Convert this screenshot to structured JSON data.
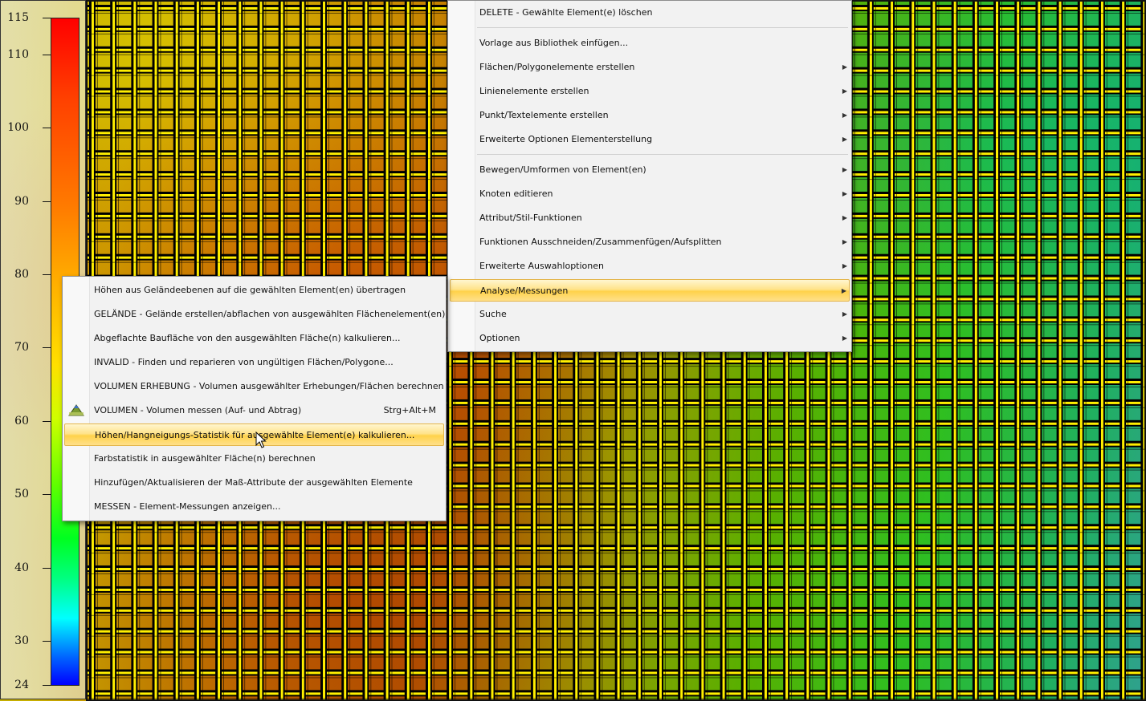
{
  "legend": {
    "ticks": [
      {
        "label": "115",
        "value": 115
      },
      {
        "label": "110",
        "value": 110
      },
      {
        "label": "100",
        "value": 100
      },
      {
        "label": "90",
        "value": 90
      },
      {
        "label": "80",
        "value": 80
      },
      {
        "label": "70",
        "value": 70
      },
      {
        "label": "60",
        "value": 60
      },
      {
        "label": "50",
        "value": 50
      },
      {
        "label": "40",
        "value": 40
      },
      {
        "label": "30",
        "value": 30
      },
      {
        "label": "24",
        "value": 24
      }
    ],
    "colors": {
      "top": "#ff0000",
      "bottom": "#0000ff"
    }
  },
  "context_menu": {
    "items": [
      {
        "label": "DELETE - Gewählte Element(e) löschen",
        "submenu": false
      },
      {
        "separator": true
      },
      {
        "label": "Vorlage aus Bibliothek einfügen...",
        "submenu": false
      },
      {
        "label": "Flächen/Polygonelemente erstellen",
        "submenu": true
      },
      {
        "label": "Linienelemente erstellen",
        "submenu": true
      },
      {
        "label": "Punkt/Textelemente erstellen",
        "submenu": true
      },
      {
        "label": "Erweiterte Optionen Elementerstellung",
        "submenu": true
      },
      {
        "separator": true
      },
      {
        "label": "Bewegen/Umformen von Element(en)",
        "submenu": true
      },
      {
        "label": "Knoten editieren",
        "submenu": true
      },
      {
        "label": "Attribut/Stil-Funktionen",
        "submenu": true
      },
      {
        "label": "Funktionen Ausschneiden/Zusammenfügen/Aufsplitten",
        "submenu": true
      },
      {
        "label": "Erweiterte Auswahloptionen",
        "submenu": true
      },
      {
        "label": "Analyse/Messungen",
        "submenu": true,
        "highlighted": true
      },
      {
        "label": "Suche",
        "submenu": true
      },
      {
        "label": "Optionen",
        "submenu": true
      }
    ]
  },
  "submenu": {
    "items": [
      {
        "label": "Höhen aus Geländeebenen auf die gewählten Element(en) übertragen"
      },
      {
        "label": "GELÄNDE - Gelände erstellen/abflachen von ausgewählten Flächenelement(en)"
      },
      {
        "label": "Abgeflachte Baufläche von den ausgewählten Fläche(n) kalkulieren..."
      },
      {
        "label": "INVALID - Finden und reparieren von ungültigen Flächen/Polygone..."
      },
      {
        "label": "VOLUMEN ERHEBUNG - Volumen ausgewählter Erhebungen/Flächen berechnen"
      },
      {
        "label": "VOLUMEN - Volumen messen (Auf- und Abtrag)",
        "shortcut": "Strg+Alt+M",
        "icon": "volume-icon"
      },
      {
        "label": "Höhen/Hangneigungs-Statistik für ausgewählte Element(e) kalkulieren...",
        "highlighted": true
      },
      {
        "label": "Farbstatistik in ausgewählter Fläche(n) berechnen"
      },
      {
        "label": "Hinzufügen/Aktualisieren der Maß-Attribute der ausgewählten Elemente"
      },
      {
        "label": "MESSEN - Element-Messungen anzeigen..."
      }
    ]
  },
  "colors": {
    "highlight": "#ffd24a",
    "grid_outline": "#ffef00"
  }
}
